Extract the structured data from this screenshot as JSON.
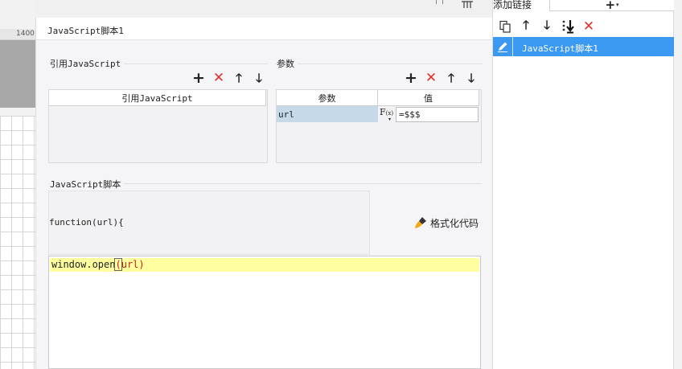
{
  "background": {
    "ruler_value": "1400"
  },
  "dialog": {
    "title": "JavaScript脚本1",
    "ref_js": {
      "group_title": "引用JavaScript",
      "column_header": "引用JavaScript"
    },
    "params": {
      "group_title": "参数",
      "columns": [
        "参数",
        "值"
      ],
      "rows": [
        {
          "name": "url",
          "formula_label": "F",
          "formula_sub": "(x)",
          "value": "=$$$"
        }
      ]
    },
    "script": {
      "group_title": "JavaScript脚本",
      "function_signature": "function(url){",
      "format_button_label": "格式化代码",
      "code_before": "window.open",
      "code_open_paren": "(",
      "code_arg": "url",
      "code_close_paren": ")"
    }
  },
  "right_panel": {
    "label": "添加链接",
    "add_button": "+",
    "items": [
      {
        "label": "JavaScript脚本1",
        "selected": true
      }
    ]
  },
  "colors": {
    "selected_bg": "#3b99f2",
    "delete_red": "#e0322c",
    "param_row_bg": "#c5d9e8",
    "code_line_highlight": "#ffffa0"
  }
}
